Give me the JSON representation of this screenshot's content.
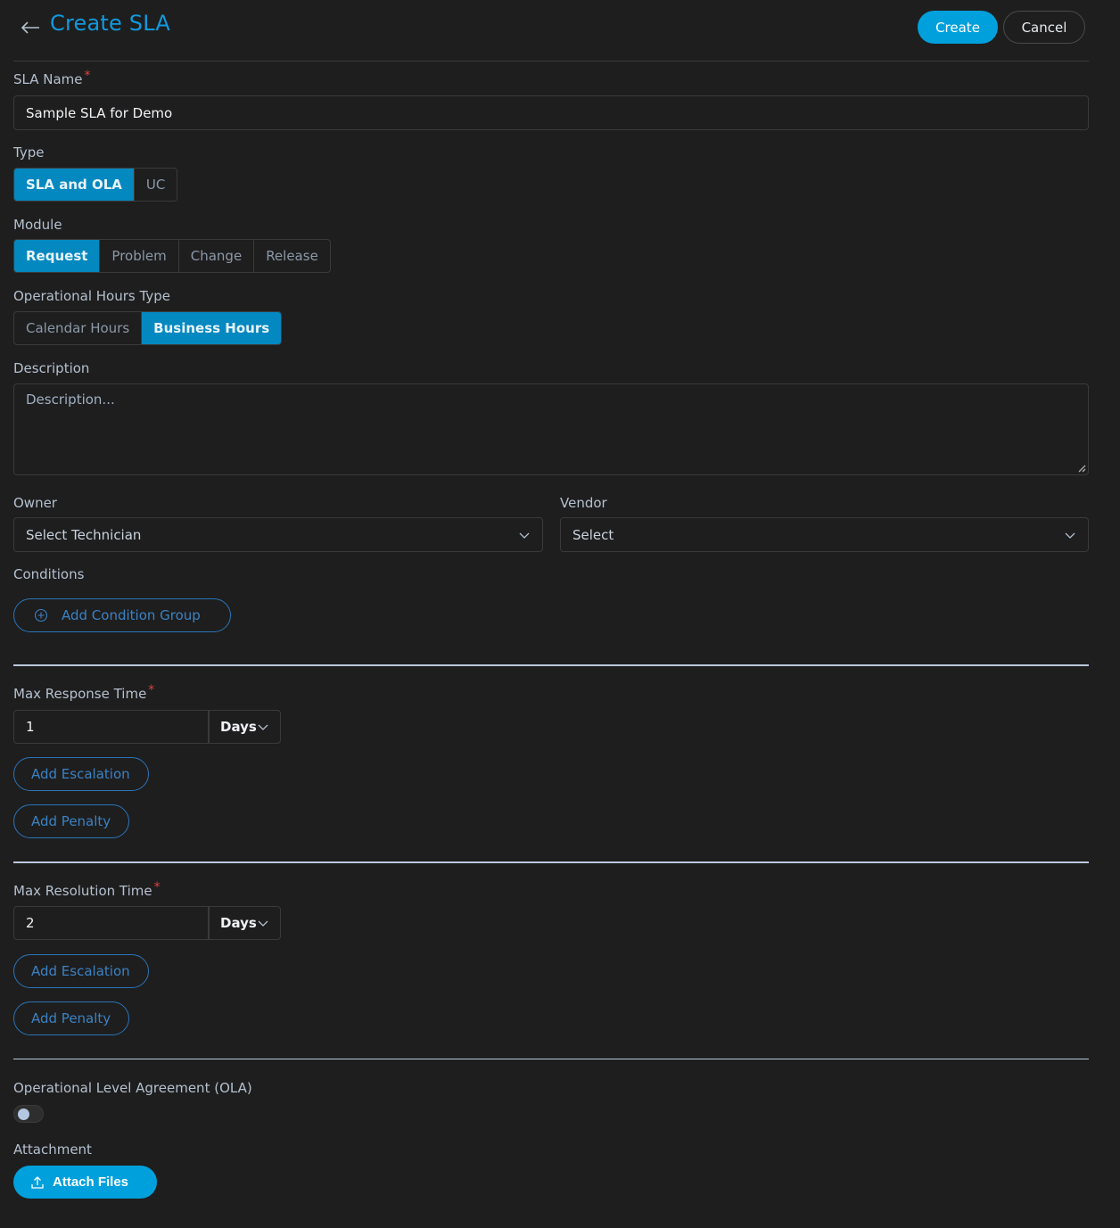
{
  "header": {
    "title": "Create SLA",
    "create_label": "Create",
    "cancel_label": "Cancel"
  },
  "colors": {
    "accent": "#00a0dc",
    "segment_active": "#0488c0",
    "required": "#e53e3e",
    "outline_link": "#3b82c4"
  },
  "form": {
    "sla_name": {
      "label": "SLA Name",
      "required": "*",
      "value": "Sample SLA for Demo"
    },
    "type": {
      "label": "Type",
      "options": [
        "SLA and OLA",
        "UC"
      ],
      "selected": "SLA and OLA"
    },
    "module": {
      "label": "Module",
      "options": [
        "Request",
        "Problem",
        "Change",
        "Release"
      ],
      "selected": "Request"
    },
    "operational_hours_type": {
      "label": "Operational Hours Type",
      "options": [
        "Calendar Hours",
        "Business Hours"
      ],
      "selected": "Business Hours"
    },
    "description": {
      "label": "Description",
      "placeholder": "Description..."
    },
    "owner": {
      "label": "Owner",
      "placeholder": "Select Technician"
    },
    "vendor": {
      "label": "Vendor",
      "placeholder": "Select"
    },
    "conditions": {
      "label": "Conditions",
      "add_group_label": "Add Condition Group"
    },
    "max_response_time": {
      "label": "Max Response Time",
      "required": "*",
      "value": "1",
      "unit": "Days",
      "add_escalation_label": "Add Escalation",
      "add_penalty_label": "Add Penalty"
    },
    "max_resolution_time": {
      "label": "Max Resolution Time",
      "required": "*",
      "value": "2",
      "unit": "Days",
      "add_escalation_label": "Add Escalation",
      "add_penalty_label": "Add Penalty"
    },
    "ola": {
      "label": "Operational Level Agreement (OLA)",
      "enabled": false
    },
    "attachment": {
      "label": "Attachment",
      "button_label": "Attach Files"
    }
  },
  "icons": {
    "back": "arrow-left-icon",
    "chevron": "chevron-down-icon",
    "add": "plus-circle-icon",
    "upload": "upload-icon"
  }
}
